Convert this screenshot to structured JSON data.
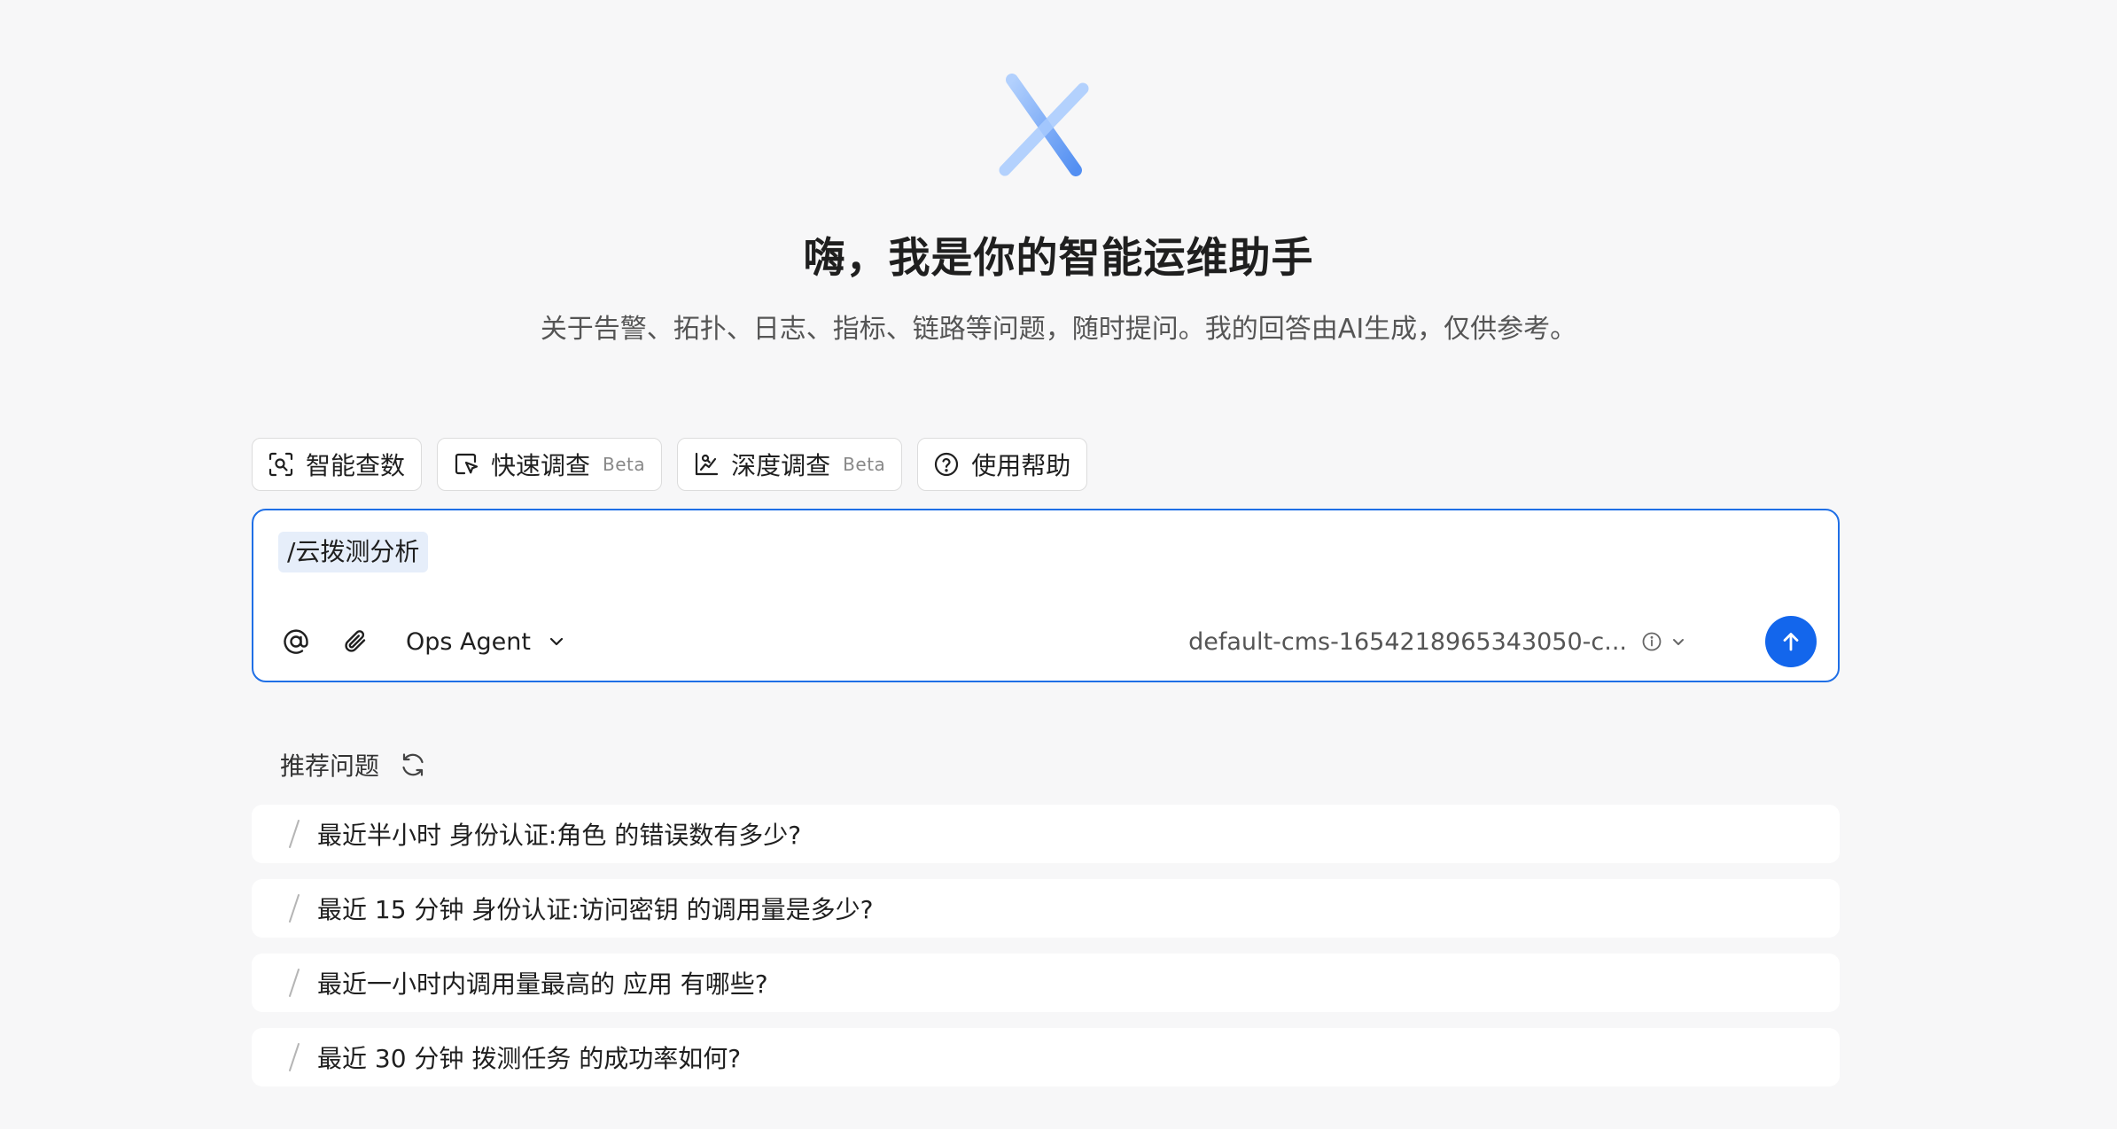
{
  "header": {
    "title": "嗨，我是你的智能运维助手",
    "subtitle": "关于告警、拓扑、日志、指标、链路等问题，随时提问。我的回答由AI生成，仅供参考。"
  },
  "modes": [
    {
      "label": "智能查数",
      "icon": "scan-search-icon",
      "badge": ""
    },
    {
      "label": "快速调查",
      "icon": "quick-cursor-icon",
      "badge": "Beta"
    },
    {
      "label": "深度调查",
      "icon": "deep-chart-icon",
      "badge": "Beta"
    },
    {
      "label": "使用帮助",
      "icon": "help-circle-icon",
      "badge": ""
    }
  ],
  "input": {
    "command_tag": "/云拨测分析",
    "agent_label": "Ops Agent",
    "workspace_label": "default-cms-1654218965343050-c..."
  },
  "suggestions": {
    "header": "推荐问题",
    "items": [
      "最近半小时 身份认证:角色 的错误数有多少?",
      "最近 15 分钟 身份认证:访问密钥 的调用量是多少?",
      "最近一小时内调用量最高的 应用 有哪些?",
      "最近 30 分钟 拨测任务 的成功率如何?"
    ]
  },
  "colors": {
    "accent": "#1366ec",
    "input_border": "#1f6fe6",
    "tag_bg": "#e6eefa",
    "page_bg": "#f7f7f8"
  }
}
